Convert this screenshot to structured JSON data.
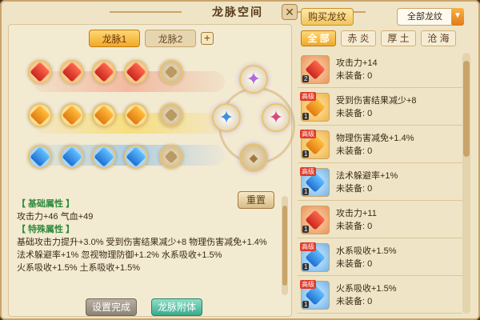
{
  "window": {
    "title": "龙脉空间",
    "close_icon": "close-icon"
  },
  "vein_tabs": [
    {
      "label": "龙脉1",
      "active": true
    },
    {
      "label": "龙脉2",
      "active": false
    }
  ],
  "add_tab_label": "+",
  "reset_label": "重置",
  "attributes": {
    "basic_header": "【 基础属性 】",
    "basic_line": "攻击力+46  气血+49",
    "special_header": "【 特殊属性 】",
    "special_lines": [
      "基础攻击力提升+3.0%  受到伤害结果减少+8  物理伤害减免+1.4%",
      "法术躲避率+1%  忽视物理防御+1.2%  水系吸收+1.5%",
      "火系吸收+1.5%  土系吸收+1.5%"
    ]
  },
  "buttons": {
    "settings_done": "设置完成",
    "attach_vein": "龙脉附体"
  },
  "right": {
    "buy_label": "购买龙纹",
    "filter_value": "全部龙纹",
    "element_tabs": [
      {
        "label": "全 部",
        "active": true
      },
      {
        "label": "赤 炎",
        "active": false
      },
      {
        "label": "厚 土",
        "active": false
      },
      {
        "label": "沧 海",
        "active": false
      }
    ],
    "items": [
      {
        "name": "攻击力+14",
        "status": "未装备: 0",
        "color": "red",
        "badge": "",
        "count": "2"
      },
      {
        "name": "受到伤害结果减少+8",
        "status": "未装备: 0",
        "color": "orange",
        "badge": "高级",
        "count": "1"
      },
      {
        "name": "物理伤害减免+1.4%",
        "status": "未装备: 0",
        "color": "orange",
        "badge": "高级",
        "count": "1"
      },
      {
        "name": "法术躲避率+1%",
        "status": "未装备: 0",
        "color": "blue",
        "badge": "高级",
        "count": "1"
      },
      {
        "name": "攻击力+11",
        "status": "未装备: 0",
        "color": "red",
        "badge": "",
        "count": "1"
      },
      {
        "name": "水系吸收+1.5%",
        "status": "未装备: 0",
        "color": "blue",
        "badge": "高级",
        "count": "1"
      },
      {
        "name": "火系吸收+1.5%",
        "status": "未装备: 0",
        "color": "blue",
        "badge": "高级",
        "count": "1"
      }
    ]
  },
  "colors": {
    "accent": "#f0a928",
    "attr_header": "#2f8a3a",
    "red_gem": "#c7261e",
    "yellow_gem": "#e07a10",
    "blue_gem": "#1f6fd1"
  }
}
